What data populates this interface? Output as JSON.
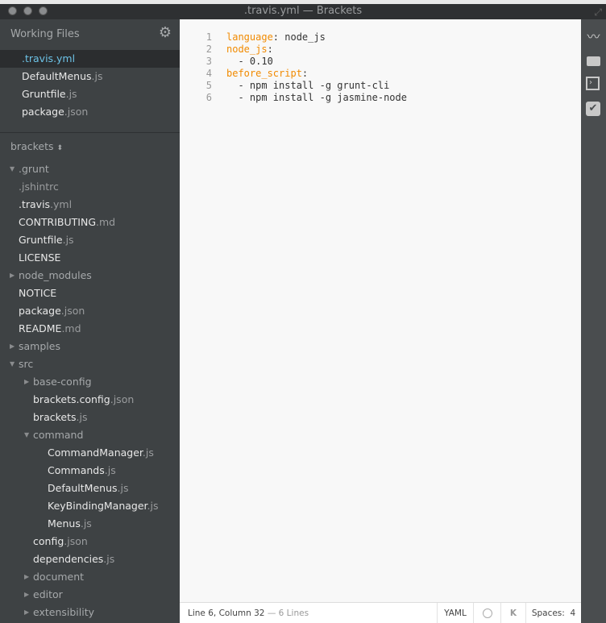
{
  "window": {
    "title": ".travis.yml — Brackets"
  },
  "working_files": {
    "title": "Working Files",
    "items": [
      {
        "name": ".travis",
        "ext": ".yml",
        "selected": true
      },
      {
        "name": "DefaultMenus",
        "ext": ".js"
      },
      {
        "name": "Gruntfile",
        "ext": ".js"
      },
      {
        "name": "package",
        "ext": ".json"
      }
    ]
  },
  "project": {
    "name": "brackets",
    "arrow": "⬍"
  },
  "tree": [
    {
      "name": ".grunt",
      "ext": "",
      "dir": true,
      "open": true,
      "level": 0
    },
    {
      "name": "",
      "ext": ".jshintrc",
      "level": 0
    },
    {
      "name": ".travis",
      "ext": ".yml",
      "level": 0
    },
    {
      "name": "CONTRIBUTING",
      "ext": ".md",
      "level": 0
    },
    {
      "name": "Gruntfile",
      "ext": ".js",
      "level": 0
    },
    {
      "name": "LICENSE",
      "ext": "",
      "level": 0
    },
    {
      "name": "node_modules",
      "ext": "",
      "dir": true,
      "level": 0
    },
    {
      "name": "NOTICE",
      "ext": "",
      "level": 0
    },
    {
      "name": "package",
      "ext": ".json",
      "level": 0
    },
    {
      "name": "README",
      "ext": ".md",
      "level": 0
    },
    {
      "name": "samples",
      "ext": "",
      "dir": true,
      "level": 0
    },
    {
      "name": "src",
      "ext": "",
      "dir": true,
      "open": true,
      "level": 0
    },
    {
      "name": "base-config",
      "ext": "",
      "dir": true,
      "level": 1
    },
    {
      "name": "brackets.config",
      "ext": ".json",
      "level": 1
    },
    {
      "name": "brackets",
      "ext": ".js",
      "level": 1
    },
    {
      "name": "command",
      "ext": "",
      "dir": true,
      "open": true,
      "level": 1
    },
    {
      "name": "CommandManager",
      "ext": ".js",
      "level": 2
    },
    {
      "name": "Commands",
      "ext": ".js",
      "level": 2
    },
    {
      "name": "DefaultMenus",
      "ext": ".js",
      "level": 2
    },
    {
      "name": "KeyBindingManager",
      "ext": ".js",
      "level": 2
    },
    {
      "name": "Menus",
      "ext": ".js",
      "level": 2
    },
    {
      "name": "config",
      "ext": ".json",
      "level": 1
    },
    {
      "name": "dependencies",
      "ext": ".js",
      "level": 1
    },
    {
      "name": "document",
      "ext": "",
      "dir": true,
      "level": 1
    },
    {
      "name": "editor",
      "ext": "",
      "dir": true,
      "level": 1
    },
    {
      "name": "extensibility",
      "ext": "",
      "dir": true,
      "level": 1
    }
  ],
  "code": [
    {
      "n": "1",
      "key": "language",
      "rest": ": node_js"
    },
    {
      "n": "2",
      "key": "node_js",
      "rest": ":"
    },
    {
      "n": "3",
      "key": "",
      "rest": "  - 0.10"
    },
    {
      "n": "4",
      "key": "before_script",
      "rest": ":"
    },
    {
      "n": "5",
      "key": "",
      "rest": "  - npm install -g grunt-cli"
    },
    {
      "n": "6",
      "key": "",
      "rest": "  - npm install -g jasmine-node"
    }
  ],
  "status": {
    "cursor": "Line 6, Column 32",
    "lines": "— 6 Lines",
    "language": "YAML",
    "linter_icon": "circle",
    "k_icon": "K",
    "spaces": "Spaces:  4"
  },
  "toolbar": [
    "live-preview-icon",
    "extension-manager-icon",
    "terminal-icon",
    "checkmark-icon"
  ],
  "colors": {
    "keyword": "#f18a00",
    "selected_file": "#6cc2e6"
  }
}
